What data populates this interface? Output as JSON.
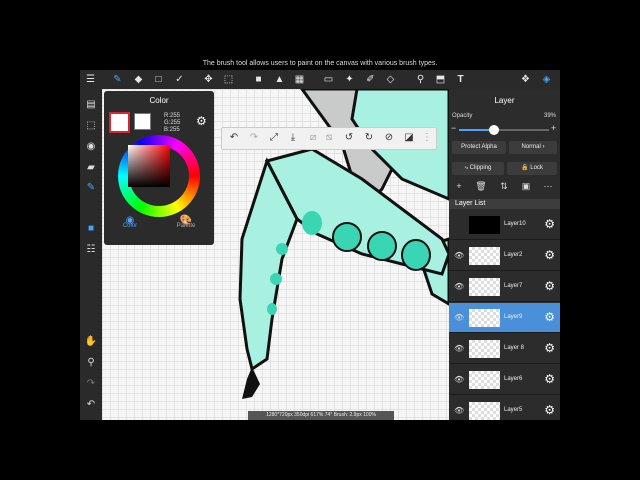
{
  "caption": "The brush tool allows users to paint on the canvas with various brush types.",
  "colors": {
    "accent": "#4aa3ff",
    "selected_layer": "#4a90d9",
    "character_fill": "#a8f0e0",
    "character_spots": "#3ad6b4"
  },
  "topbar": {
    "icons": [
      "menu-icon",
      "brush-icon",
      "eraser-icon",
      "square-icon",
      "smudge-icon",
      "move-icon",
      "fill-icon",
      "bucket-icon",
      "gradient-icon",
      "selection-icon",
      "magic-wand-icon",
      "select-pen-icon",
      "select-eraser-icon",
      "eyedropper-icon",
      "text-icon",
      "3d-icon",
      "layers-icon"
    ]
  },
  "color_panel": {
    "title": "Color",
    "rgb": {
      "r": "R:255",
      "g": "G:255",
      "b": "B:255"
    },
    "tabs": {
      "color": "Color",
      "palette": "Palette"
    }
  },
  "status_bar": {
    "text": "1280*720px 350dpi 617% 74° Brush: 2.9px 100%"
  },
  "layer_panel": {
    "title": "Layer",
    "opacity_label": "Opacity",
    "opacity_value": "39%",
    "opacity_fraction": 0.39,
    "protect_alpha_label": "Protect Alpha",
    "blend_mode": "Normal",
    "clipping_label": "Clipping",
    "lock_label": "Lock",
    "list_header": "Layer List",
    "layers": [
      {
        "name": "Layer10",
        "visible": false,
        "selected": false
      },
      {
        "name": "Layer2",
        "visible": true,
        "selected": false
      },
      {
        "name": "Layer7",
        "visible": true,
        "selected": false
      },
      {
        "name": "Layer9",
        "visible": true,
        "selected": true
      },
      {
        "name": "Layer 8",
        "visible": true,
        "selected": false
      },
      {
        "name": "Layer6",
        "visible": true,
        "selected": false
      },
      {
        "name": "Layer5",
        "visible": true,
        "selected": false
      }
    ]
  }
}
